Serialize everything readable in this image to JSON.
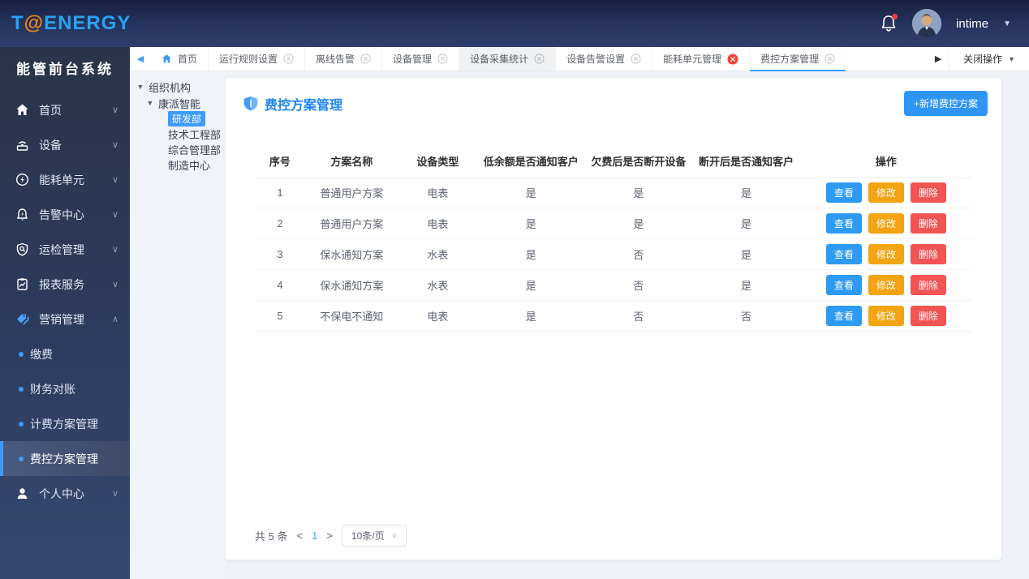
{
  "colors": {
    "accent": "#409eff",
    "primary_button": "#2f95f5",
    "view_button": "#2d9af3",
    "edit_button": "#f2a413",
    "delete_button": "#f25353",
    "header_bg": "#27355f",
    "sidebar_bg": "#2c3c5e",
    "title_blue": "#2086f0",
    "logo_blue": "#28a3f2",
    "logo_orange": "#f18616"
  },
  "icons": {
    "caret_down": "▼",
    "caret_up": "▲",
    "caret_left": "◀",
    "caret_right": "▶",
    "chevron_down": "∨",
    "chevron_up": "∧",
    "prev": "<",
    "next": ">"
  },
  "header": {
    "logo_t": "T",
    "logo_at": "@",
    "logo_rest": "ENERGY",
    "username": "intime"
  },
  "sidebar": {
    "title": "能管前台系统",
    "items": [
      {
        "label": "首页",
        "icon": "home-icon"
      },
      {
        "label": "设备",
        "icon": "device-icon"
      },
      {
        "label": "能耗单元",
        "icon": "energy-icon"
      },
      {
        "label": "告警中心",
        "icon": "alarm-icon"
      },
      {
        "label": "运检管理",
        "icon": "inspection-icon"
      },
      {
        "label": "报表服务",
        "icon": "report-icon"
      },
      {
        "label": "营销管理",
        "icon": "marketing-icon",
        "expanded": true
      }
    ],
    "submenu": [
      {
        "label": "缴费"
      },
      {
        "label": "财务对账"
      },
      {
        "label": "计费方案管理"
      },
      {
        "label": "费控方案管理",
        "active": true
      }
    ],
    "personal": {
      "label": "个人中心",
      "icon": "user-icon"
    }
  },
  "tabbar": {
    "tabs": [
      {
        "label": "首页"
      },
      {
        "label": "运行规则设置"
      },
      {
        "label": "离线告警"
      },
      {
        "label": "设备管理"
      },
      {
        "label": "设备采集统计"
      },
      {
        "label": "设备告警设置"
      },
      {
        "label": "能耗单元管理"
      },
      {
        "label": "费控方案管理"
      }
    ],
    "close_ops": "关闭操作"
  },
  "tree": {
    "root": "组织机构",
    "company": "康派智能",
    "departments": [
      "研发部",
      "技术工程部",
      "综合管理部",
      "制造中心"
    ],
    "selected": "研发部"
  },
  "main": {
    "title": "费控方案管理",
    "add_button": "+新增费控方案",
    "table": {
      "headers": [
        "序号",
        "方案名称",
        "设备类型",
        "低余额是否通知客户",
        "欠费后是否断开设备",
        "断开后是否通知客户",
        "操作"
      ],
      "rows": [
        {
          "no": "1",
          "name": "普通用户方案",
          "type": "电表",
          "low_balance_notify": "是",
          "disconnect_on_arrears": "是",
          "notify_after_disconnect": "是"
        },
        {
          "no": "2",
          "name": "普通用户方案",
          "type": "电表",
          "low_balance_notify": "是",
          "disconnect_on_arrears": "是",
          "notify_after_disconnect": "是"
        },
        {
          "no": "3",
          "name": "保水通知方案",
          "type": "水表",
          "low_balance_notify": "是",
          "disconnect_on_arrears": "否",
          "notify_after_disconnect": "是"
        },
        {
          "no": "4",
          "name": "保水通知方案",
          "type": "水表",
          "low_balance_notify": "是",
          "disconnect_on_arrears": "否",
          "notify_after_disconnect": "是"
        },
        {
          "no": "5",
          "name": "不保电不通知",
          "type": "电表",
          "low_balance_notify": "是",
          "disconnect_on_arrears": "否",
          "notify_after_disconnect": "否"
        }
      ]
    },
    "actions": {
      "view": "查看",
      "edit": "修改",
      "delete": "删除"
    },
    "pagination": {
      "total": "共 5 条",
      "page": "1",
      "page_size": "10条/页"
    }
  }
}
